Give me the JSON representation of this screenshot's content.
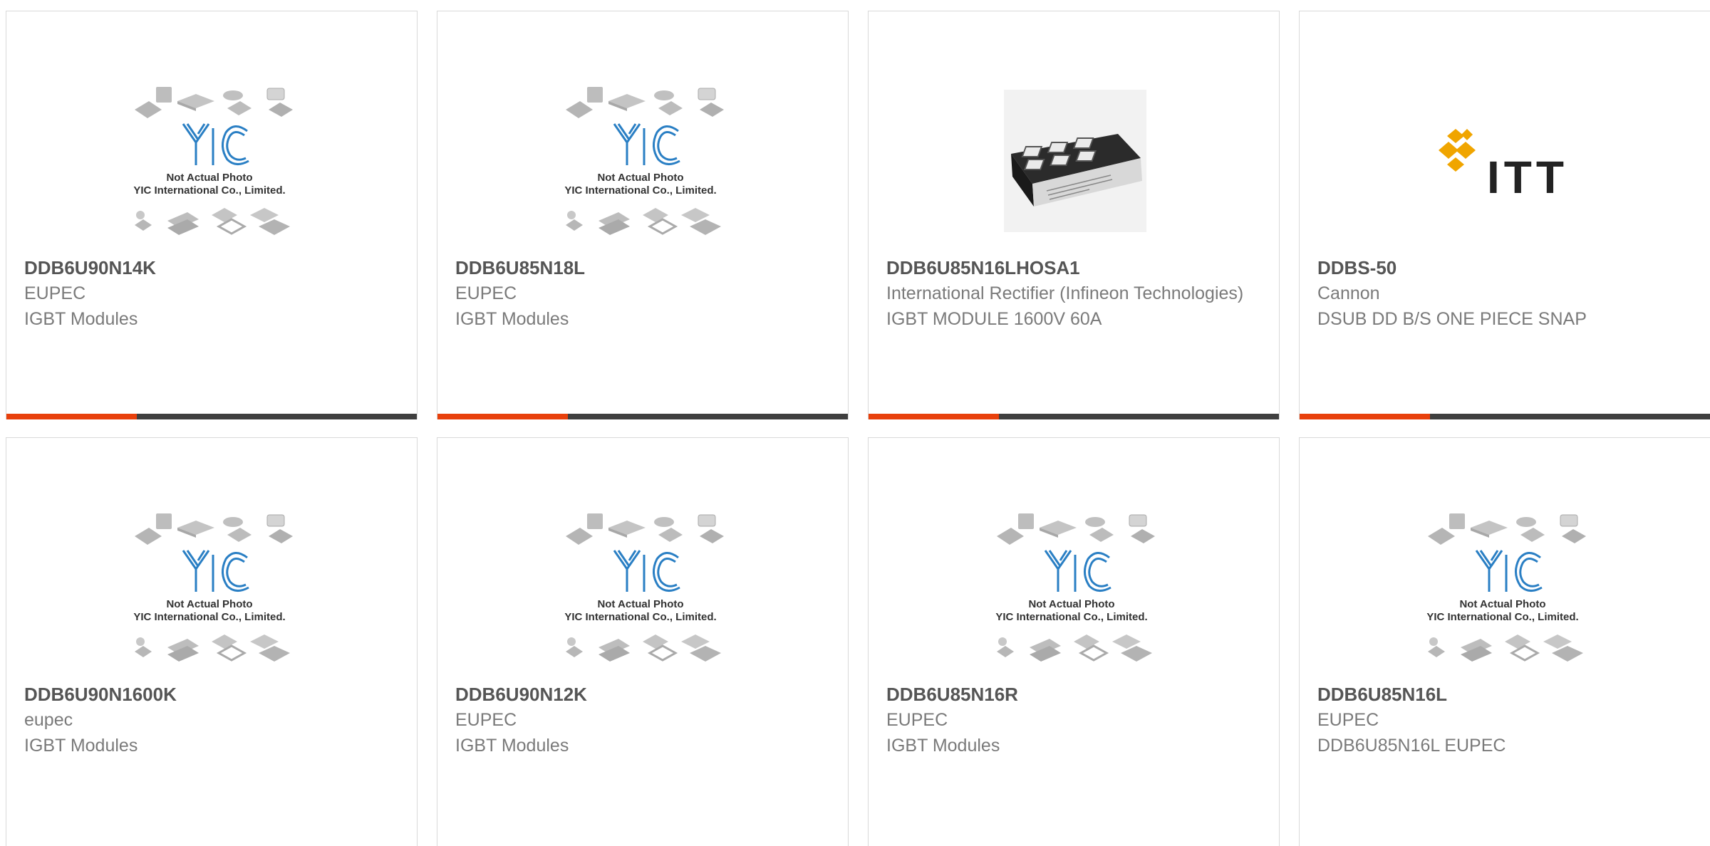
{
  "placeholder": {
    "line1": "Not Actual Photo",
    "line2": "YIC International Co., Limited."
  },
  "brand_logo_text": "ITT",
  "colors": {
    "accent": "#e8400c",
    "bar": "#3f3f3f",
    "part_text": "#555555",
    "meta_text": "#7a7a7a",
    "yic_blue": "#2a7fc4"
  },
  "products": [
    {
      "part": "DDB6U90N14K",
      "maker": "EUPEC",
      "desc": "IGBT Modules",
      "image": "placeholder"
    },
    {
      "part": "DDB6U85N18L",
      "maker": "EUPEC",
      "desc": "IGBT Modules",
      "image": "placeholder"
    },
    {
      "part": "DDB6U85N16LHOSA1",
      "maker": "International Rectifier (Infineon Technologies)",
      "desc": "IGBT MODULE 1600V 60A",
      "image": "igbt-module-photo"
    },
    {
      "part": "DDBS-50",
      "maker": "Cannon",
      "desc": "DSUB DD B/S ONE PIECE SNAP",
      "image": "itt-logo"
    },
    {
      "part": "DDB6U90N1600K",
      "maker": "eupec",
      "desc": "IGBT Modules",
      "image": "placeholder"
    },
    {
      "part": "DDB6U90N12K",
      "maker": "EUPEC",
      "desc": "IGBT Modules",
      "image": "placeholder"
    },
    {
      "part": "DDB6U85N16R",
      "maker": "EUPEC",
      "desc": "IGBT Modules",
      "image": "placeholder"
    },
    {
      "part": "DDB6U85N16L",
      "maker": "EUPEC",
      "desc": "DDB6U85N16L EUPEC",
      "image": "placeholder"
    }
  ]
}
